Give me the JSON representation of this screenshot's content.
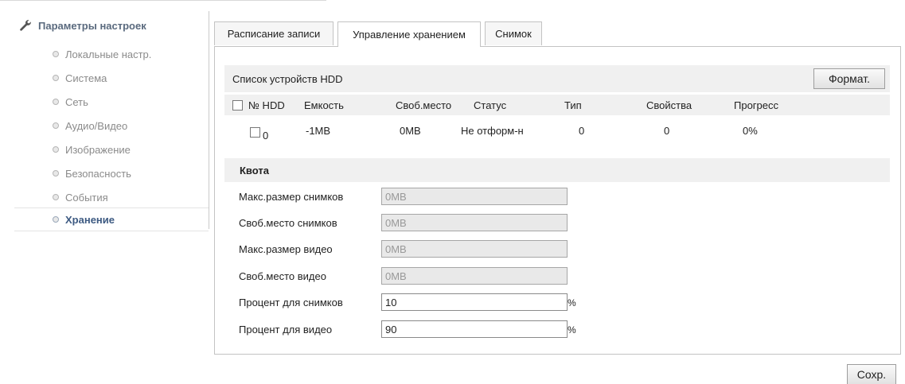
{
  "sidebar": {
    "title": "Параметры настроек",
    "items": [
      {
        "label": "Локальные настр."
      },
      {
        "label": "Система"
      },
      {
        "label": "Сеть"
      },
      {
        "label": "Аудио/Видео"
      },
      {
        "label": "Изображение"
      },
      {
        "label": "Безопасность"
      },
      {
        "label": "События"
      },
      {
        "label": "Хранение",
        "active": true
      }
    ]
  },
  "tabs": [
    {
      "label": "Расписание записи"
    },
    {
      "label": "Управление хранением",
      "active": true
    },
    {
      "label": "Снимок"
    }
  ],
  "hdd": {
    "title": "Список устройств HDD",
    "format_label": "Формат.",
    "columns": [
      "№ HDD",
      "Емкость",
      "Своб.место",
      "Статус",
      "Тип",
      "Свойства",
      "Прогресс"
    ],
    "rows": [
      {
        "no": "0",
        "capacity": "-1MB",
        "free": "0MB",
        "status": "Не отформ-н",
        "type": "0",
        "property": "0",
        "progress": "0%"
      }
    ]
  },
  "quota": {
    "title": "Квота",
    "fields": [
      {
        "label": "Макс.размер снимков",
        "value": "0MB"
      },
      {
        "label": "Своб.место снимков",
        "value": "0MB"
      },
      {
        "label": "Макс.размер видео",
        "value": "0MB"
      },
      {
        "label": "Своб.место видео",
        "value": "0MB"
      },
      {
        "label": "Процент для снимков",
        "value": "10",
        "unit": "%"
      },
      {
        "label": "Процент для видео",
        "value": "90",
        "unit": "%"
      }
    ]
  },
  "save_label": "Сохр."
}
